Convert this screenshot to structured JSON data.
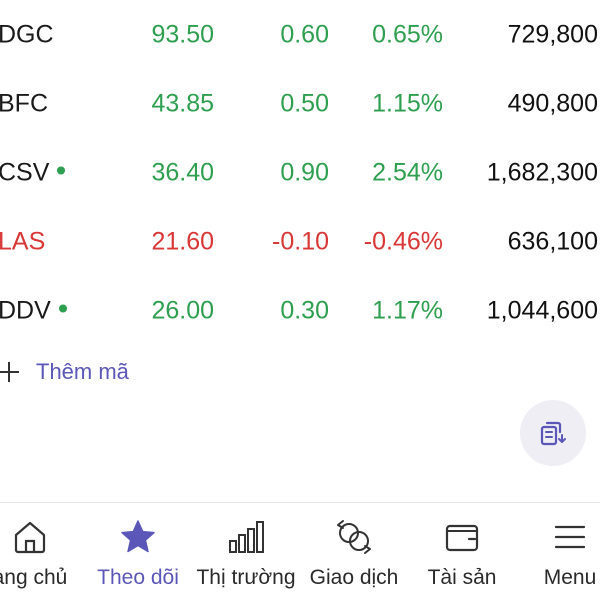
{
  "colors": {
    "up": "#2e9e4f",
    "down": "#d93636",
    "accent": "#5b57b8"
  },
  "watchlist": {
    "rows": [
      {
        "symbol": "DGC",
        "price": "93.50",
        "change": "0.60",
        "percent": "0.65%",
        "volume": "729,800",
        "trend": "up",
        "dot": false
      },
      {
        "symbol": "BFC",
        "price": "43.85",
        "change": "0.50",
        "percent": "1.15%",
        "volume": "490,800",
        "trend": "up",
        "dot": false
      },
      {
        "symbol": "CSV",
        "price": "36.40",
        "change": "0.90",
        "percent": "2.54%",
        "volume": "1,682,300",
        "trend": "up",
        "dot": true
      },
      {
        "symbol": "LAS",
        "price": "21.60",
        "change": "-0.10",
        "percent": "-0.46%",
        "volume": "636,100",
        "trend": "down",
        "dot": false
      },
      {
        "symbol": "DDV",
        "price": "26.00",
        "change": "0.30",
        "percent": "1.17%",
        "volume": "1,044,600",
        "trend": "up",
        "dot": true
      }
    ],
    "add_label": "Thêm mã"
  },
  "fab_icon": "swap-list-icon",
  "tabs": [
    {
      "label": "ang chủ",
      "icon": "home-icon",
      "active": false
    },
    {
      "label": "Theo dõi",
      "icon": "star-icon",
      "active": true
    },
    {
      "label": "Thị trường",
      "icon": "bar-chart-icon",
      "active": false
    },
    {
      "label": "Giao dịch",
      "icon": "exchange-icon",
      "active": false
    },
    {
      "label": "Tài sản",
      "icon": "wallet-icon",
      "active": false
    },
    {
      "label": "Menu",
      "icon": "menu-icon",
      "active": false
    }
  ]
}
